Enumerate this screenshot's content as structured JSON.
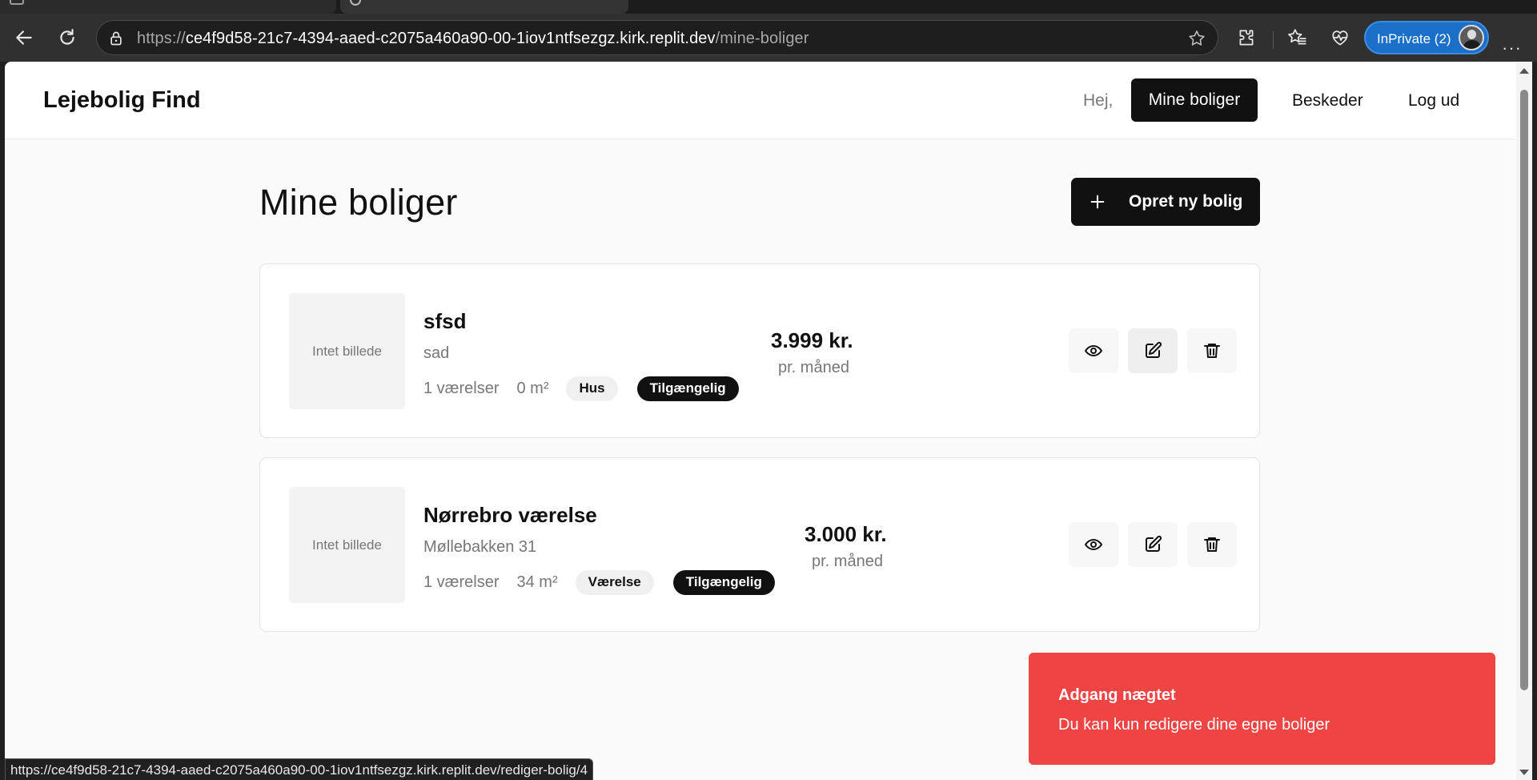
{
  "browser": {
    "url_prefix": "https://",
    "url_host": "ce4f9d58-21c7-4394-aaed-c2075a460a90-00-1iov1ntfsezgz.kirk.replit.dev",
    "url_path": "/mine-boliger",
    "inprivate_label": "InPrivate (2)",
    "menu_label": "···",
    "status_url": "https://ce4f9d58-21c7-4394-aaed-c2075a460a90-00-1iov1ntfsezgz.kirk.replit.dev/rediger-bolig/4"
  },
  "header": {
    "brand": "Lejebolig Find",
    "greeting": "Hej,",
    "nav": {
      "mine_boliger": "Mine boliger",
      "beskeder": "Beskeder",
      "log_ud": "Log ud"
    }
  },
  "main": {
    "title": "Mine boliger",
    "create_label": "Opret ny bolig",
    "listings": [
      {
        "thumb_text": "Intet billede",
        "title": "sfsd",
        "address": "sad",
        "rooms": "1 værelser",
        "area": "0 m²",
        "type": "Hus",
        "status": "Tilgængelig",
        "price": "3.999 kr.",
        "period": "pr. måned"
      },
      {
        "thumb_text": "Intet billede",
        "title": "Nørrebro værelse",
        "address": "Møllebakken 31",
        "rooms": "1 værelser",
        "area": "34 m²",
        "type": "Værelse",
        "status": "Tilgængelig",
        "price": "3.000 kr.",
        "period": "pr. måned"
      }
    ]
  },
  "toast": {
    "title": "Adgang nægtet",
    "message": "Du kan kun redigere dine egne boliger"
  },
  "colors": {
    "primary": "#111111",
    "toast_bg": "#ef4444",
    "browser_accent": "#1a6fc9",
    "page_bg": "#fafafa"
  },
  "icons": [
    "back-arrow-icon",
    "reload-icon",
    "lock-icon",
    "star-icon",
    "extensions-icon",
    "favorites-icon",
    "browser-essentials-icon",
    "plus-icon",
    "eye-icon",
    "edit-icon",
    "trash-icon"
  ]
}
